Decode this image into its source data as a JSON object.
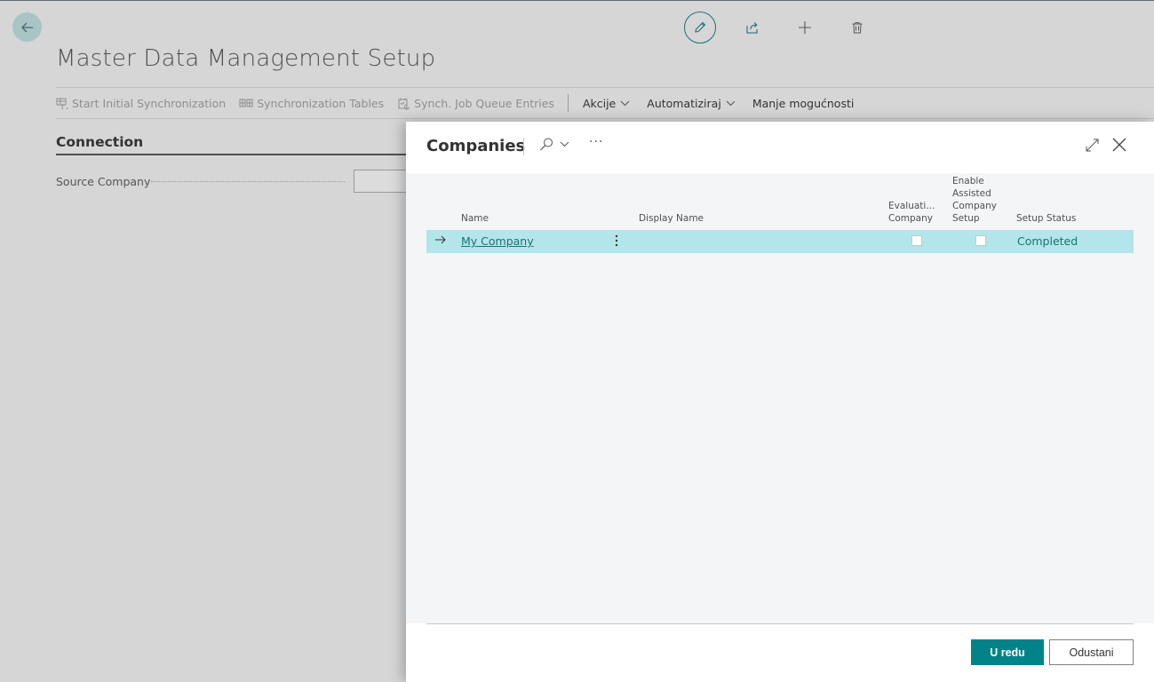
{
  "page": {
    "title": "Master Data Management Setup",
    "actions": [
      {
        "label": "Start Initial Synchronization",
        "icon": "sync-table-icon",
        "enabled": false
      },
      {
        "label": "Synchronization Tables",
        "icon": "tables-icon",
        "enabled": false
      },
      {
        "label": "Synch. Job Queue Entries",
        "icon": "job-queue-icon",
        "enabled": false
      },
      {
        "label": "Akcije",
        "icon": "chevron-down-icon",
        "enabled": true
      },
      {
        "label": "Automatiziraj",
        "icon": "chevron-down-icon",
        "enabled": true
      },
      {
        "label": "Manje mogućnosti",
        "icon": "",
        "enabled": true
      }
    ],
    "section": "Connection",
    "field_label": "Source Company"
  },
  "modal": {
    "title": "Companies",
    "more_label": "···",
    "columns": {
      "name": "Name",
      "display_name": "Display Name",
      "evaluation": [
        "Evaluati...",
        "Company"
      ],
      "assisted": [
        "Enable",
        "Assisted",
        "Company",
        "Setup"
      ],
      "status": "Setup Status"
    },
    "rows": [
      {
        "name": "My Company",
        "display_name": "",
        "evaluation": false,
        "assisted": false,
        "status": "Completed"
      }
    ],
    "ok_label": "U redu",
    "cancel_label": "Odustani"
  },
  "colors": {
    "accent": "#008489",
    "selected_row": "#b2e6ea",
    "link": "#1f6f73"
  }
}
